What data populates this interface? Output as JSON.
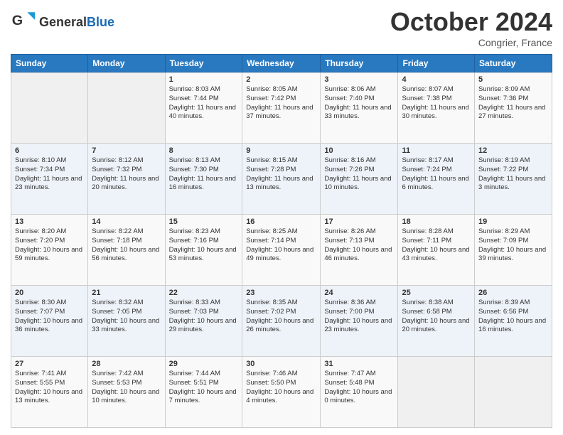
{
  "header": {
    "logo_general": "General",
    "logo_blue": "Blue",
    "month": "October 2024",
    "location": "Congrier, France"
  },
  "weekdays": [
    "Sunday",
    "Monday",
    "Tuesday",
    "Wednesday",
    "Thursday",
    "Friday",
    "Saturday"
  ],
  "weeks": [
    [
      {
        "day": "",
        "sunrise": "",
        "sunset": "",
        "daylight": "",
        "empty": true
      },
      {
        "day": "",
        "sunrise": "",
        "sunset": "",
        "daylight": "",
        "empty": true
      },
      {
        "day": "1",
        "sunrise": "Sunrise: 8:03 AM",
        "sunset": "Sunset: 7:44 PM",
        "daylight": "Daylight: 11 hours and 40 minutes."
      },
      {
        "day": "2",
        "sunrise": "Sunrise: 8:05 AM",
        "sunset": "Sunset: 7:42 PM",
        "daylight": "Daylight: 11 hours and 37 minutes."
      },
      {
        "day": "3",
        "sunrise": "Sunrise: 8:06 AM",
        "sunset": "Sunset: 7:40 PM",
        "daylight": "Daylight: 11 hours and 33 minutes."
      },
      {
        "day": "4",
        "sunrise": "Sunrise: 8:07 AM",
        "sunset": "Sunset: 7:38 PM",
        "daylight": "Daylight: 11 hours and 30 minutes."
      },
      {
        "day": "5",
        "sunrise": "Sunrise: 8:09 AM",
        "sunset": "Sunset: 7:36 PM",
        "daylight": "Daylight: 11 hours and 27 minutes."
      }
    ],
    [
      {
        "day": "6",
        "sunrise": "Sunrise: 8:10 AM",
        "sunset": "Sunset: 7:34 PM",
        "daylight": "Daylight: 11 hours and 23 minutes."
      },
      {
        "day": "7",
        "sunrise": "Sunrise: 8:12 AM",
        "sunset": "Sunset: 7:32 PM",
        "daylight": "Daylight: 11 hours and 20 minutes."
      },
      {
        "day": "8",
        "sunrise": "Sunrise: 8:13 AM",
        "sunset": "Sunset: 7:30 PM",
        "daylight": "Daylight: 11 hours and 16 minutes."
      },
      {
        "day": "9",
        "sunrise": "Sunrise: 8:15 AM",
        "sunset": "Sunset: 7:28 PM",
        "daylight": "Daylight: 11 hours and 13 minutes."
      },
      {
        "day": "10",
        "sunrise": "Sunrise: 8:16 AM",
        "sunset": "Sunset: 7:26 PM",
        "daylight": "Daylight: 11 hours and 10 minutes."
      },
      {
        "day": "11",
        "sunrise": "Sunrise: 8:17 AM",
        "sunset": "Sunset: 7:24 PM",
        "daylight": "Daylight: 11 hours and 6 minutes."
      },
      {
        "day": "12",
        "sunrise": "Sunrise: 8:19 AM",
        "sunset": "Sunset: 7:22 PM",
        "daylight": "Daylight: 11 hours and 3 minutes."
      }
    ],
    [
      {
        "day": "13",
        "sunrise": "Sunrise: 8:20 AM",
        "sunset": "Sunset: 7:20 PM",
        "daylight": "Daylight: 10 hours and 59 minutes."
      },
      {
        "day": "14",
        "sunrise": "Sunrise: 8:22 AM",
        "sunset": "Sunset: 7:18 PM",
        "daylight": "Daylight: 10 hours and 56 minutes."
      },
      {
        "day": "15",
        "sunrise": "Sunrise: 8:23 AM",
        "sunset": "Sunset: 7:16 PM",
        "daylight": "Daylight: 10 hours and 53 minutes."
      },
      {
        "day": "16",
        "sunrise": "Sunrise: 8:25 AM",
        "sunset": "Sunset: 7:14 PM",
        "daylight": "Daylight: 10 hours and 49 minutes."
      },
      {
        "day": "17",
        "sunrise": "Sunrise: 8:26 AM",
        "sunset": "Sunset: 7:13 PM",
        "daylight": "Daylight: 10 hours and 46 minutes."
      },
      {
        "day": "18",
        "sunrise": "Sunrise: 8:28 AM",
        "sunset": "Sunset: 7:11 PM",
        "daylight": "Daylight: 10 hours and 43 minutes."
      },
      {
        "day": "19",
        "sunrise": "Sunrise: 8:29 AM",
        "sunset": "Sunset: 7:09 PM",
        "daylight": "Daylight: 10 hours and 39 minutes."
      }
    ],
    [
      {
        "day": "20",
        "sunrise": "Sunrise: 8:30 AM",
        "sunset": "Sunset: 7:07 PM",
        "daylight": "Daylight: 10 hours and 36 minutes."
      },
      {
        "day": "21",
        "sunrise": "Sunrise: 8:32 AM",
        "sunset": "Sunset: 7:05 PM",
        "daylight": "Daylight: 10 hours and 33 minutes."
      },
      {
        "day": "22",
        "sunrise": "Sunrise: 8:33 AM",
        "sunset": "Sunset: 7:03 PM",
        "daylight": "Daylight: 10 hours and 29 minutes."
      },
      {
        "day": "23",
        "sunrise": "Sunrise: 8:35 AM",
        "sunset": "Sunset: 7:02 PM",
        "daylight": "Daylight: 10 hours and 26 minutes."
      },
      {
        "day": "24",
        "sunrise": "Sunrise: 8:36 AM",
        "sunset": "Sunset: 7:00 PM",
        "daylight": "Daylight: 10 hours and 23 minutes."
      },
      {
        "day": "25",
        "sunrise": "Sunrise: 8:38 AM",
        "sunset": "Sunset: 6:58 PM",
        "daylight": "Daylight: 10 hours and 20 minutes."
      },
      {
        "day": "26",
        "sunrise": "Sunrise: 8:39 AM",
        "sunset": "Sunset: 6:56 PM",
        "daylight": "Daylight: 10 hours and 16 minutes."
      }
    ],
    [
      {
        "day": "27",
        "sunrise": "Sunrise: 7:41 AM",
        "sunset": "Sunset: 5:55 PM",
        "daylight": "Daylight: 10 hours and 13 minutes."
      },
      {
        "day": "28",
        "sunrise": "Sunrise: 7:42 AM",
        "sunset": "Sunset: 5:53 PM",
        "daylight": "Daylight: 10 hours and 10 minutes."
      },
      {
        "day": "29",
        "sunrise": "Sunrise: 7:44 AM",
        "sunset": "Sunset: 5:51 PM",
        "daylight": "Daylight: 10 hours and 7 minutes."
      },
      {
        "day": "30",
        "sunrise": "Sunrise: 7:46 AM",
        "sunset": "Sunset: 5:50 PM",
        "daylight": "Daylight: 10 hours and 4 minutes."
      },
      {
        "day": "31",
        "sunrise": "Sunrise: 7:47 AM",
        "sunset": "Sunset: 5:48 PM",
        "daylight": "Daylight: 10 hours and 0 minutes."
      },
      {
        "day": "",
        "sunrise": "",
        "sunset": "",
        "daylight": "",
        "empty": true
      },
      {
        "day": "",
        "sunrise": "",
        "sunset": "",
        "daylight": "",
        "empty": true
      }
    ]
  ]
}
